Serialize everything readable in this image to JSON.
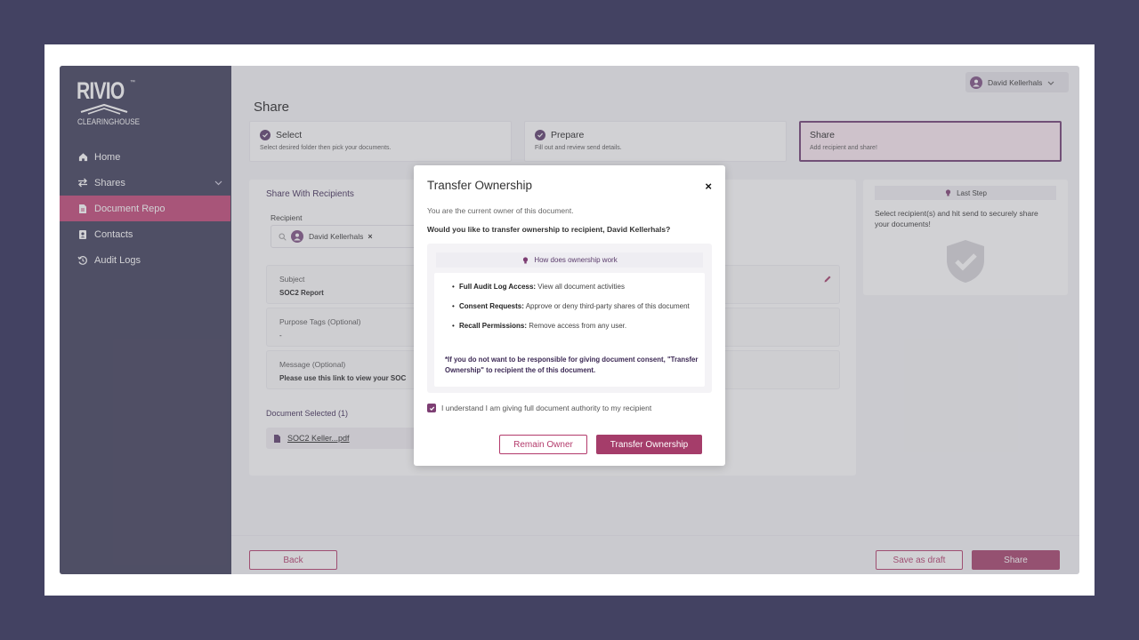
{
  "brand": {
    "name": "RIVIO",
    "tm": "™",
    "sub": "CLEARINGHOUSE"
  },
  "sidebar": {
    "items": [
      {
        "label": "Home",
        "icon": "home-icon"
      },
      {
        "label": "Shares",
        "icon": "arrows-icon"
      },
      {
        "label": "Document Repo",
        "icon": "document-icon",
        "active": true
      },
      {
        "label": "Contacts",
        "icon": "contacts-icon"
      },
      {
        "label": "Audit Logs",
        "icon": "history-icon"
      }
    ]
  },
  "header": {
    "user_name": "David Kellerhals"
  },
  "page": {
    "title": "Share"
  },
  "steps": [
    {
      "title": "Select",
      "desc": "Select desired folder then pick your documents."
    },
    {
      "title": "Prepare",
      "desc": "Fill out and review send details."
    },
    {
      "title": "Share",
      "desc": "Add recipient and share!"
    }
  ],
  "share_card": {
    "heading": "Share With Recipients",
    "recipient_label": "Recipient",
    "recipient_name": "David Kellerhals",
    "subject_label": "Subject",
    "subject_value": "SOC2 Report",
    "tags_label": "Purpose Tags (Optional)",
    "tags_value": "-",
    "message_label": "Message (Optional)",
    "message_value": "Please use this link to view your SOC",
    "doc_selected": "Document Selected (1)",
    "doc_name": "SOC2 Keller...pdf"
  },
  "side": {
    "title": "Last Step",
    "text": "Select recipient(s) and hit send to securely share your documents!"
  },
  "footer": {
    "back": "Back",
    "draft": "Save as draft",
    "share": "Share"
  },
  "modal": {
    "title": "Transfer Ownership",
    "close": "×",
    "subtitle": "You are the current owner of this document.",
    "question": "Would you like to transfer ownership to recipient, David Kellerhals?",
    "info_title": "How does ownership work",
    "bullets": [
      {
        "strong": "Full Audit Log Access:",
        "text": " View all document activities"
      },
      {
        "strong": "Consent Requests:",
        "text": " Approve or deny third-party shares of this document"
      },
      {
        "strong": "Recall Permissions:",
        "text": " Remove access from any user."
      }
    ],
    "note": "*If you do not want to be responsible for giving document consent, \"Transfer Ownership\" to recipient the of this document.",
    "checkbox": "I understand I am giving full document authority to my recipient",
    "checkbox_checked": true,
    "remain": "Remain Owner",
    "transfer": "Transfer Ownership"
  },
  "colors": {
    "accent": "#a53d6a",
    "sidebar": "#3b3a57",
    "background": "#434262"
  }
}
